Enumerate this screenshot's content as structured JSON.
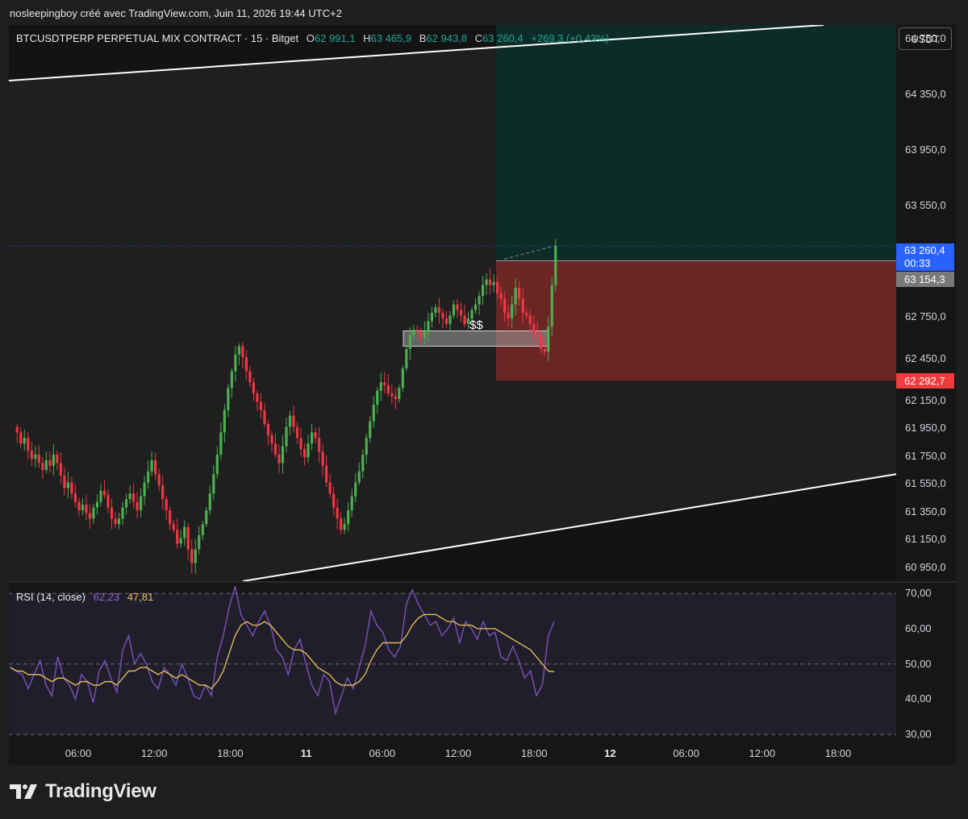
{
  "snapshot_header": "nosleepingboy créé avec TradingView.com, Juin 11, 2026 19:44 UTC+2",
  "legend": {
    "symbol": "BTCUSDTPERP PERPETUAL MIX CONTRACT · 15 · Bitget",
    "open_label": "O",
    "open": "62 991,1",
    "high_label": "H",
    "high": "63 465,9",
    "low_label": "B",
    "low": "62 943,8",
    "close_label": "C",
    "close": "63 260,4",
    "change": "+269,3 (+0,43%)"
  },
  "currency_button": "USDT",
  "price_tags": {
    "last_price": "63 260,4",
    "countdown": "00:33",
    "entry": "63 154,3",
    "stop": "62 292,7"
  },
  "annotation": "$$",
  "rsi": {
    "title": "RSI (14, close)",
    "value": "62,23",
    "ma_value": "47,81"
  },
  "brand": "TradingView",
  "colors": {
    "up": "#26a69a",
    "up_candle": "#4caf50",
    "down_candle": "#f23645",
    "rsi_line": "#7e57c2",
    "rsi_ma": "#e8c45a",
    "target_zone": "#0d2b27",
    "stop_zone": "#6b2525",
    "last_price": "#2962ff",
    "channel": "#ffffff"
  },
  "chart_data": [
    {
      "type": "candlestick",
      "title": "BTCUSDTPERP PERPETUAL MIX CONTRACT · 15 · Bitget",
      "y_ticks": [
        "64 750,0",
        "64 350,0",
        "63 950,0",
        "63 550,0",
        "62 750,0",
        "62 450,0",
        "62 150,0",
        "61 950,0",
        "61 750,0",
        "61 550,0",
        "61 350,0",
        "61 150,0",
        "60 950,0"
      ],
      "x_ticks": [
        "06:00",
        "12:00",
        "18:00",
        "11",
        "06:00",
        "12:00",
        "18:00",
        "12",
        "06:00",
        "12:00",
        "18:00"
      ],
      "x_tick_bold": [
        false,
        false,
        false,
        true,
        false,
        false,
        false,
        true,
        false,
        false,
        false
      ],
      "ylim": [
        60850,
        64850
      ],
      "last_price": 63260.4,
      "position": {
        "entry": 63154.3,
        "stop": 62292.7,
        "target_top": 64850
      },
      "liquidity_zone": {
        "low": 62540,
        "high": 62650
      },
      "channel": [
        {
          "from": [
            0,
            64450
          ],
          "to": [
            1010,
            64850
          ]
        },
        {
          "from": [
            290,
            60850
          ],
          "to": [
            1100,
            61620
          ]
        }
      ],
      "closes": [
        61920,
        61840,
        61880,
        61790,
        61730,
        61760,
        61700,
        61650,
        61720,
        61680,
        61760,
        61700,
        61610,
        61520,
        61560,
        61480,
        61420,
        61360,
        61400,
        61340,
        61300,
        61380,
        61420,
        61500,
        61470,
        61380,
        61300,
        61260,
        61300,
        61380,
        61440,
        61480,
        61420,
        61360,
        61460,
        61560,
        61640,
        61720,
        61620,
        61540,
        61440,
        61360,
        61260,
        61220,
        61120,
        61160,
        61240,
        61080,
        60980,
        61080,
        61180,
        61260,
        61360,
        61480,
        61620,
        61760,
        61920,
        62080,
        62240,
        62360,
        62480,
        62540,
        62460,
        62360,
        62280,
        62200,
        62140,
        62080,
        61980,
        61900,
        61840,
        61760,
        61700,
        61820,
        61960,
        62040,
        61960,
        61880,
        61800,
        61740,
        61840,
        61920,
        61880,
        61780,
        61680,
        61560,
        61480,
        61380,
        61300,
        61220,
        61260,
        61360,
        61460,
        61560,
        61640,
        61760,
        61880,
        62000,
        62120,
        62220,
        62280,
        62260,
        62200,
        62180,
        62160,
        62240,
        62380,
        62520,
        62620,
        62660,
        62640,
        62600,
        62640,
        62720,
        62780,
        62820,
        62780,
        62740,
        62700,
        62760,
        62840,
        62800,
        62760,
        62700,
        62740,
        62800,
        62840,
        62900,
        62980,
        63020,
        62980,
        63000,
        62920,
        62880,
        62780,
        62740,
        62840,
        62960,
        62880,
        62780,
        62760,
        62700,
        62640,
        62620,
        62520,
        62500,
        62680,
        62980,
        63260
      ]
    },
    {
      "type": "line",
      "title": "RSI (14, close)",
      "y_ticks": [
        "70,00",
        "60,00",
        "50,00",
        "40,00",
        "30,00"
      ],
      "ylim": [
        28,
        73
      ],
      "bands": [
        70,
        50,
        30
      ],
      "series": [
        {
          "name": "RSI (14, close)",
          "values": [
            49,
            48,
            47,
            43,
            47,
            51,
            44,
            41,
            52,
            46,
            44,
            40,
            47,
            45,
            39,
            48,
            51,
            46,
            42,
            54,
            58,
            50,
            53,
            50,
            45,
            43,
            49,
            47,
            44,
            50,
            46,
            41,
            40,
            44,
            41,
            52,
            58,
            66,
            72,
            64,
            61,
            58,
            62,
            65,
            61,
            54,
            52,
            47,
            54,
            57,
            50,
            44,
            41,
            47,
            45,
            36,
            41,
            46,
            43,
            49,
            55,
            65,
            61,
            59,
            54,
            52,
            55,
            67,
            71,
            67,
            64,
            61,
            62,
            58,
            60,
            63,
            56,
            62,
            60,
            57,
            62,
            58,
            59,
            52,
            51,
            55,
            51,
            46,
            48,
            41,
            44,
            58,
            62
          ]
        },
        {
          "name": "RSI-based MA",
          "values": [
            49,
            48,
            48,
            47,
            47,
            47,
            46,
            45,
            46,
            46,
            45,
            44,
            45,
            45,
            44,
            44,
            45,
            45,
            44,
            46,
            48,
            48,
            49,
            49,
            48,
            47,
            48,
            47,
            46,
            47,
            46,
            45,
            44,
            44,
            43,
            45,
            48,
            53,
            58,
            61,
            62,
            61,
            61,
            62,
            61,
            59,
            57,
            55,
            54,
            54,
            53,
            51,
            49,
            48,
            47,
            45,
            44,
            44,
            44,
            45,
            47,
            51,
            54,
            56,
            56,
            56,
            56,
            58,
            61,
            63,
            64,
            64,
            64,
            63,
            62,
            62,
            61,
            61,
            61,
            60,
            60,
            60,
            60,
            59,
            58,
            57,
            56,
            55,
            54,
            52,
            50,
            48,
            47.8
          ]
        }
      ]
    }
  ]
}
